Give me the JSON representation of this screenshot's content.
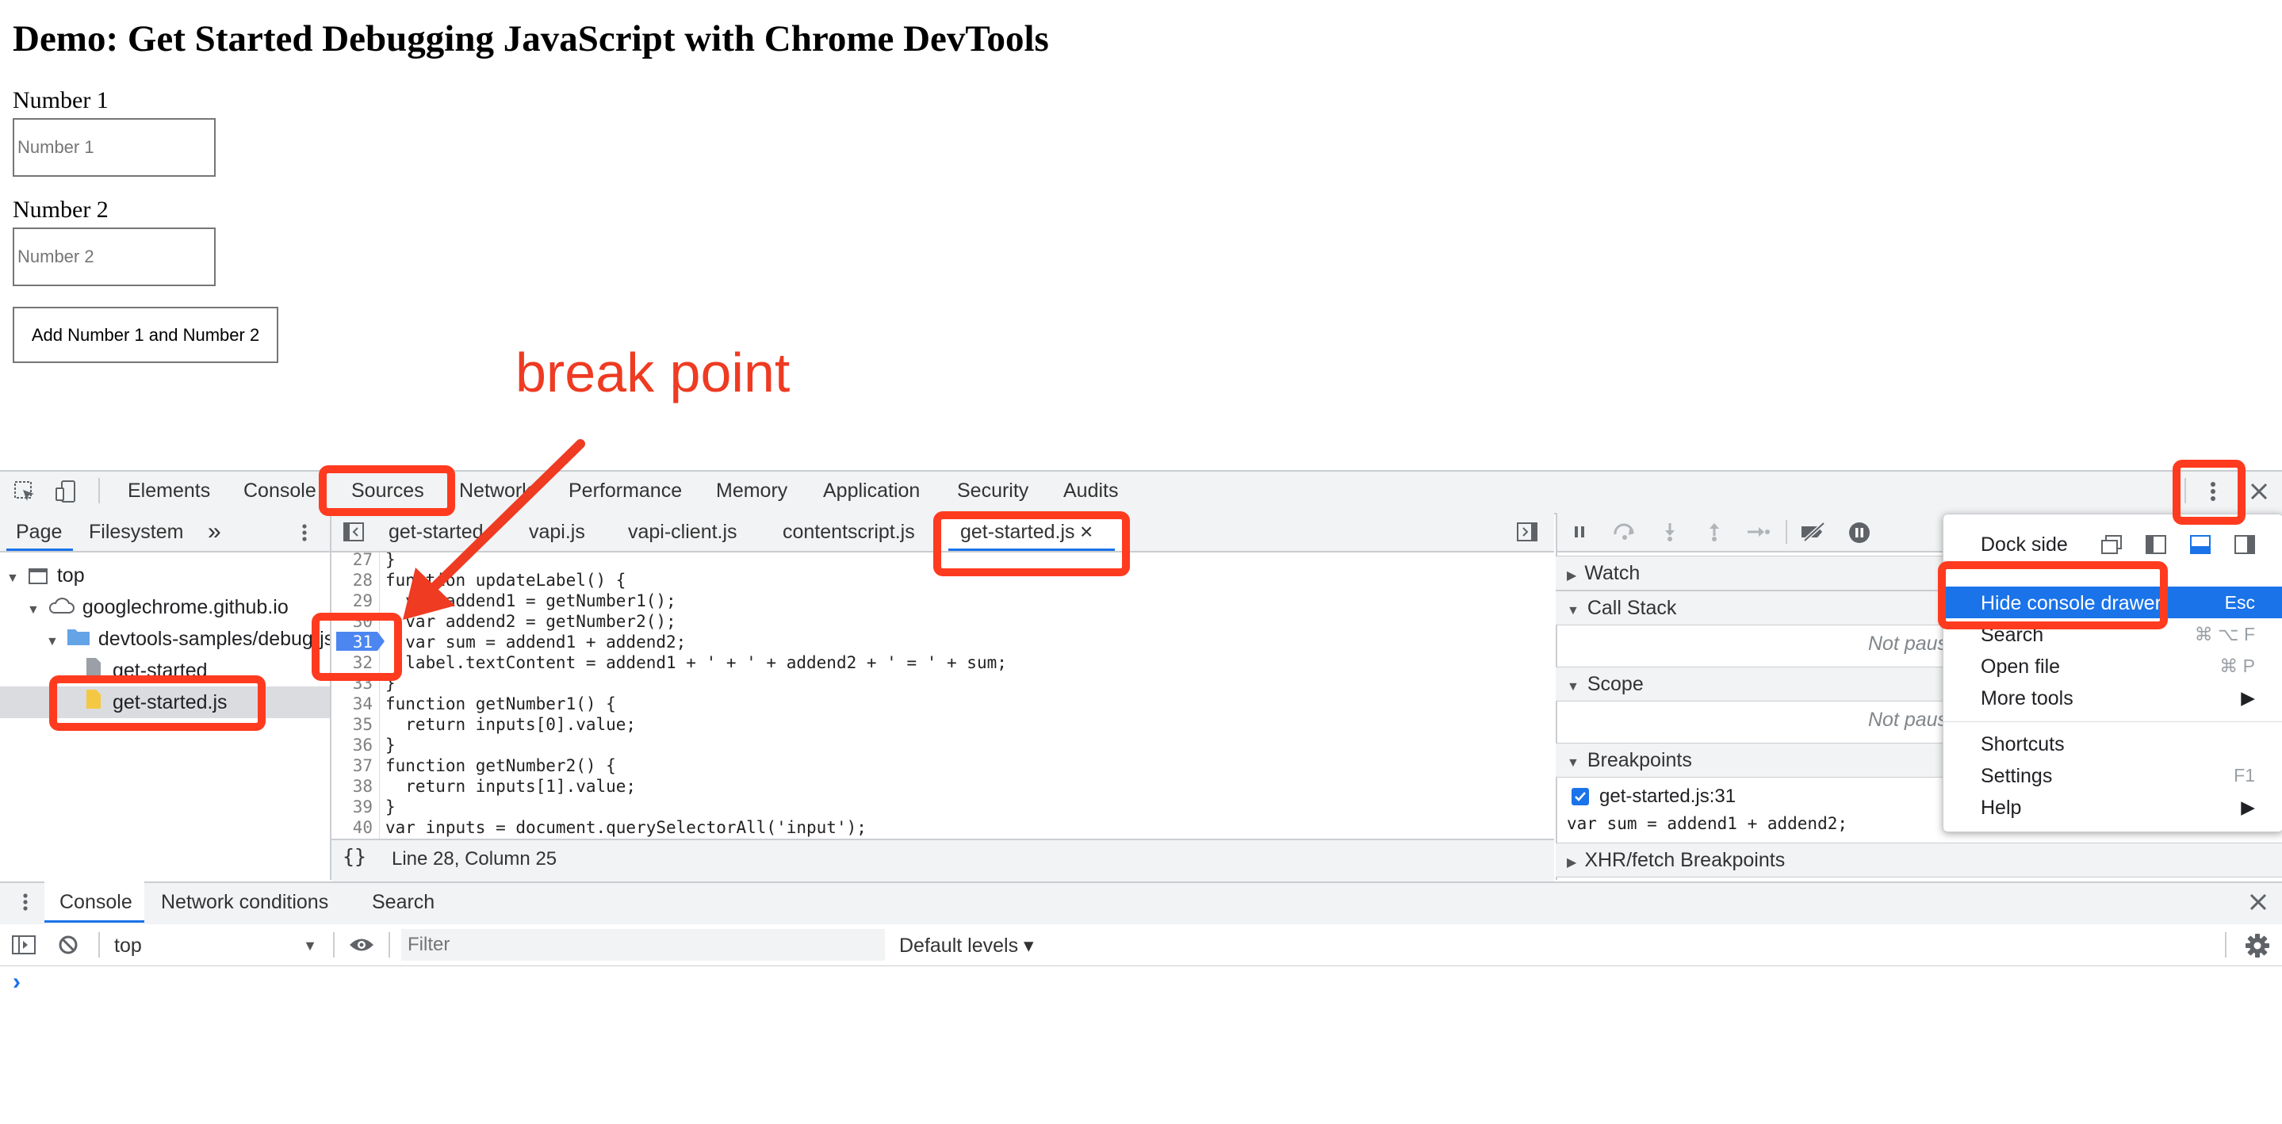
{
  "demo": {
    "title": "Demo: Get Started Debugging JavaScript with Chrome DevTools",
    "label1": "Number 1",
    "placeholder1": "Number 1",
    "label2": "Number 2",
    "placeholder2": "Number 2",
    "button": "Add Number 1 and Number 2"
  },
  "annotation": {
    "text": "break point",
    "color": "#ee3b22"
  },
  "devtools": {
    "main_tabs": [
      "Elements",
      "Console",
      "Sources",
      "Network",
      "Performance",
      "Memory",
      "Application",
      "Security",
      "Audits"
    ],
    "active_tab": "Sources",
    "navigator": {
      "tabs": [
        "Page",
        "Filesystem"
      ],
      "more": "»",
      "tree": [
        {
          "label": "top"
        },
        {
          "label": "googlechrome.github.io"
        },
        {
          "label": "devtools-samples/debug-js"
        },
        {
          "label": "get-started"
        },
        {
          "label": "get-started.js",
          "selected": true
        }
      ]
    },
    "file_tabs": [
      "get-started",
      "vapi.js",
      "vapi-client.js",
      "contentscript.js",
      "get-started.js"
    ],
    "active_file": "get-started.js",
    "close_glyph": "×",
    "code": {
      "lines": [
        {
          "n": "27",
          "text": "}"
        },
        {
          "n": "28",
          "text": "function updateLabel() {"
        },
        {
          "n": "29",
          "text": "  var addend1 = getNumber1();"
        },
        {
          "n": "30",
          "text": "  var addend2 = getNumber2();"
        },
        {
          "n": "31",
          "text": "  var sum = addend1 + addend2;"
        },
        {
          "n": "32",
          "text": "  label.textContent = addend1 + ' + ' + addend2 + ' = ' + sum;"
        },
        {
          "n": "33",
          "text": "}"
        },
        {
          "n": "34",
          "text": "function getNumber1() {"
        },
        {
          "n": "35",
          "text": "  return inputs[0].value;"
        },
        {
          "n": "36",
          "text": "}"
        },
        {
          "n": "37",
          "text": "function getNumber2() {"
        },
        {
          "n": "38",
          "text": "  return inputs[1].value;"
        },
        {
          "n": "39",
          "text": "}"
        },
        {
          "n": "40",
          "text": "var inputs = document.querySelectorAll('input');"
        }
      ],
      "breakpoint_line": "31"
    },
    "status": {
      "braces": "{}",
      "position": "Line 28, Column 25"
    },
    "sidebar": {
      "sections": [
        "Watch",
        "Call Stack",
        "Scope",
        "Breakpoints",
        "XHR/fetch Breakpoints"
      ],
      "not_paused": "Not paused",
      "breakpoint": {
        "label": "get-started.js:31",
        "code": "var sum = addend1 + addend2;"
      }
    },
    "menu": {
      "dock_side": "Dock side",
      "items": [
        {
          "label": "Hide console drawer",
          "shortcut": "Esc"
        },
        {
          "label": "Search",
          "shortcut": "⌘ ⌥ F"
        },
        {
          "label": "Open file",
          "shortcut": "⌘ P"
        },
        {
          "label": "More tools",
          "shortcut": "▶"
        },
        {
          "label": "Shortcuts",
          "shortcut": ""
        },
        {
          "label": "Settings",
          "shortcut": "F1"
        },
        {
          "label": "Help",
          "shortcut": "▶"
        }
      ]
    },
    "drawer": {
      "tabs": [
        "Console",
        "Network conditions",
        "Search"
      ],
      "context": "top",
      "filter_placeholder": "Filter",
      "levels": "Default levels ▾",
      "prompt": "›"
    }
  },
  "colors": {
    "accent": "#1a73e8",
    "highlight": "#ff3b1f",
    "menu_selected": "#1a73e8"
  }
}
